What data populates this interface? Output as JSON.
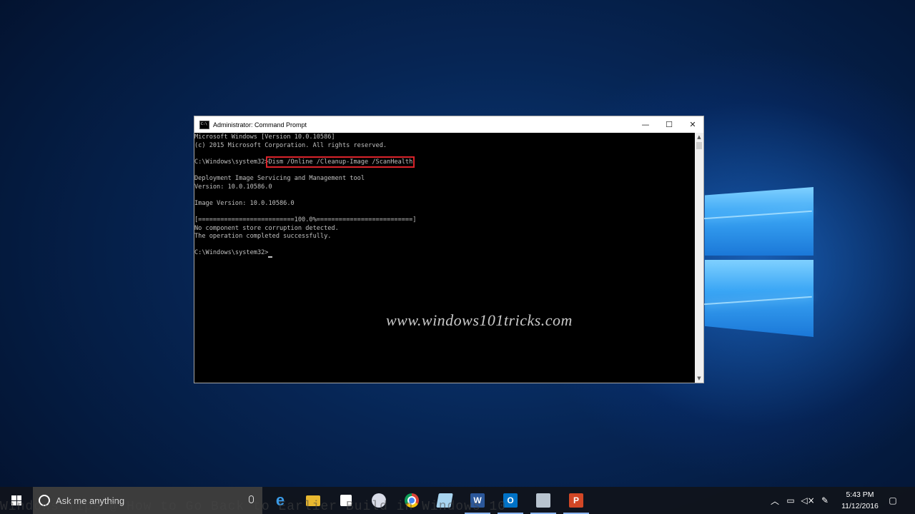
{
  "window": {
    "title": "Administrator: Command Prompt",
    "minimize_glyph": "—",
    "maximize_glyph": "☐",
    "close_glyph": "✕",
    "icon": "cmd-icon"
  },
  "console": {
    "lines": [
      "Microsoft Windows [Version 10.0.10586]",
      "(c) 2015 Microsoft Corporation. All rights reserved.",
      "",
      "",
      "",
      "Deployment Image Servicing and Management tool",
      "Version: 10.0.10586.0",
      "",
      "Image Version: 10.0.10586.0",
      "",
      "[==========================100.0%==========================]",
      "No component store corruption detected.",
      "The operation completed successfully.",
      "",
      ""
    ],
    "prompt1": "C:\\Windows\\system32>",
    "command": "Dism /Online /Cleanup-Image /ScanHealth",
    "prompt2": "C:\\Windows\\system32>"
  },
  "watermark": "www.windows101tricks.com",
  "taskbar": {
    "search_placeholder": "Ask me anything",
    "apps": [
      {
        "name": "edge",
        "icon": "edge-icon",
        "color": "#1e7fd8",
        "glyph": "e"
      },
      {
        "name": "file-explorer",
        "icon": "folder-icon",
        "color": "#f0c040",
        "glyph": ""
      },
      {
        "name": "store",
        "icon": "store-icon",
        "color": "#ffffff",
        "glyph": ""
      },
      {
        "name": "paint",
        "icon": "paint-icon",
        "color": "#d0d8e8",
        "glyph": ""
      },
      {
        "name": "chrome",
        "icon": "chrome-icon",
        "color": "#3cba54",
        "glyph": ""
      },
      {
        "name": "notepad",
        "icon": "notepad-icon",
        "color": "#9fd0f0",
        "glyph": ""
      },
      {
        "name": "word",
        "icon": "word-icon",
        "color": "#2b579a",
        "glyph": "W"
      },
      {
        "name": "outlook",
        "icon": "outlook-icon",
        "color": "#0072c6",
        "glyph": "O"
      },
      {
        "name": "remote",
        "icon": "remote-desktop-icon",
        "color": "#b8c4d0",
        "glyph": ""
      },
      {
        "name": "powerpoint",
        "icon": "powerpoint-icon",
        "color": "#d24726",
        "glyph": "P"
      }
    ],
    "clock_time": "5:43 PM",
    "clock_date": "11/12/2016"
  },
  "video_caption": "Windows Tips @ How to Go Back to Earlier Build in Windows 10"
}
